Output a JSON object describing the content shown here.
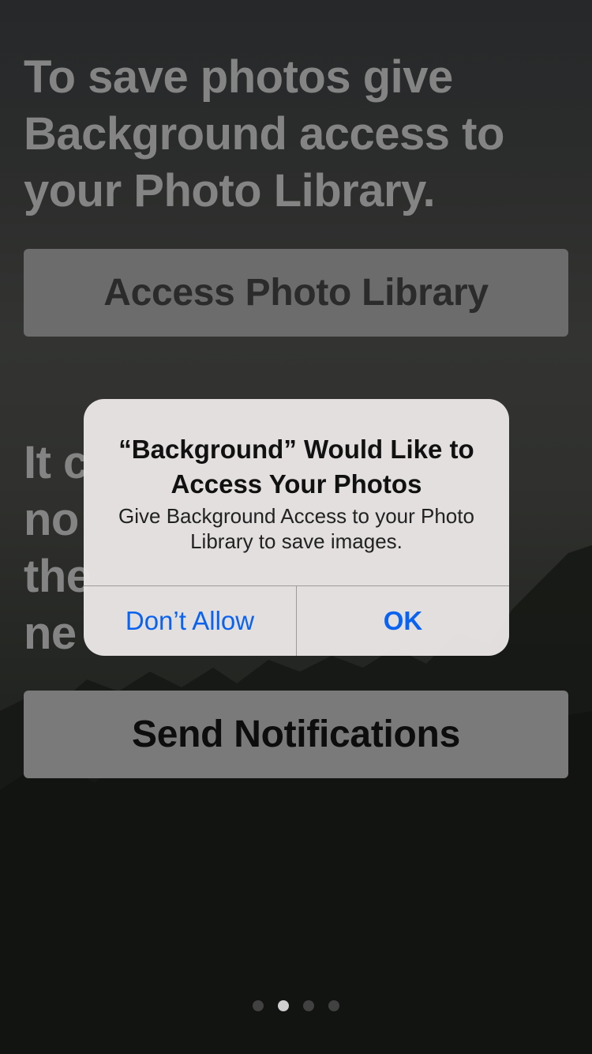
{
  "screen": {
    "heading_photos": "To save photos give Background access to your Photo Library.",
    "access_button_label": "Access Photo Library",
    "heading_notifications": "It c\nno\nthe\nne",
    "notifications_button_label": "Send Notifications"
  },
  "alert": {
    "title": "“Background” Would Like to Access Your Photos",
    "message": "Give Background Access to your Photo Library to save images.",
    "dont_allow_label": "Don’t Allow",
    "ok_label": "OK"
  },
  "pagination": {
    "count": 4,
    "active_index": 1
  },
  "colors": {
    "alert_button": "#0a63f0",
    "heading_text": "#848484"
  }
}
